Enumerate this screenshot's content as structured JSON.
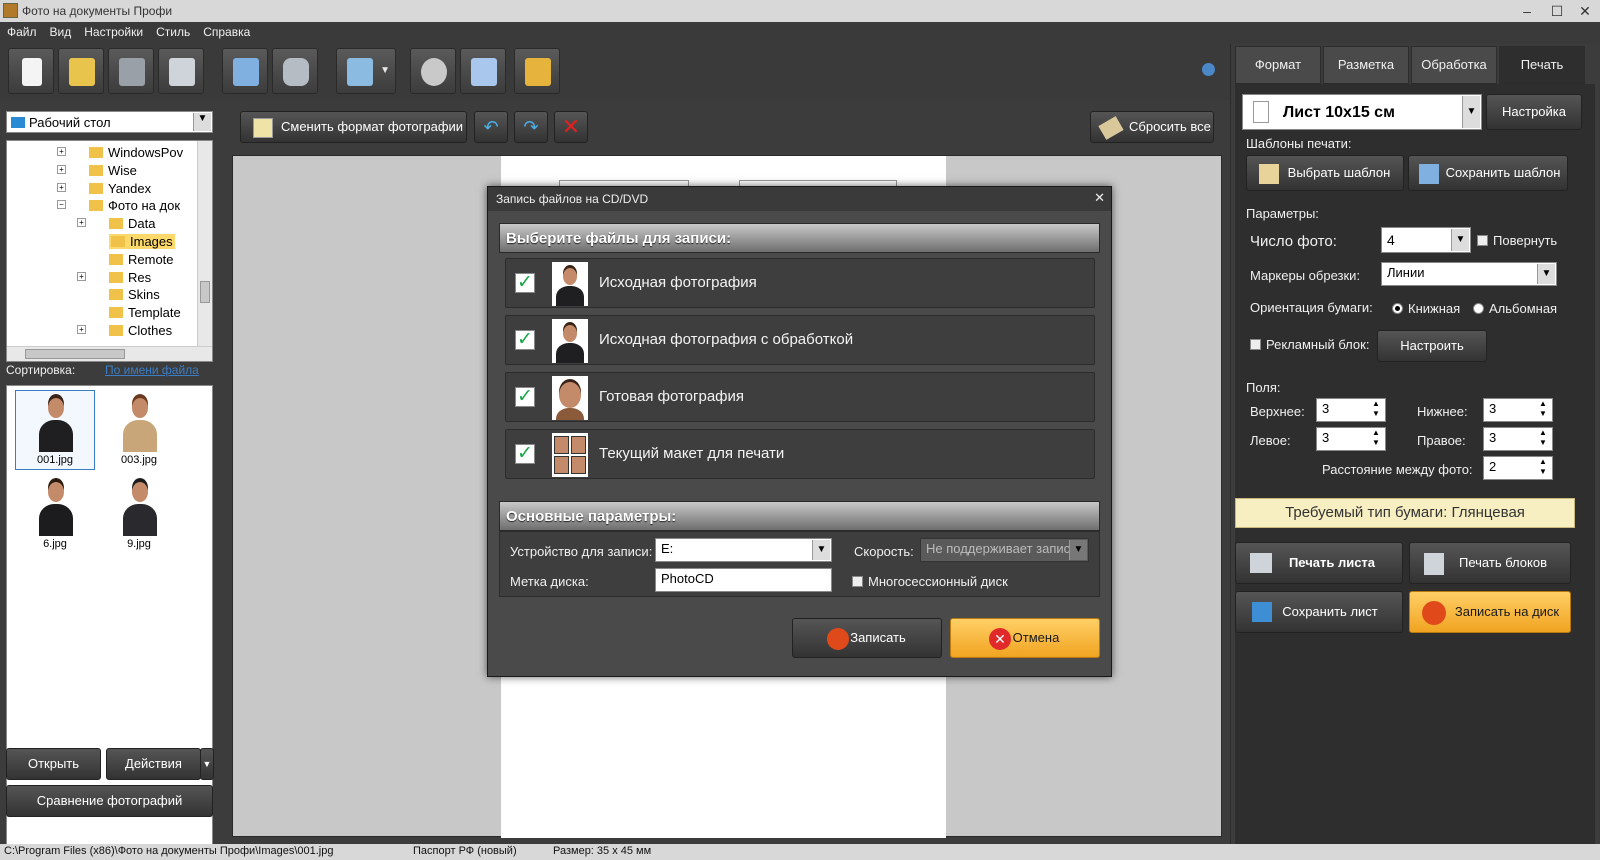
{
  "window": {
    "title": "Фото на документы Профи"
  },
  "menu": [
    "Файл",
    "Вид",
    "Настройки",
    "Стиль",
    "Справка"
  ],
  "folder_select": {
    "value": "Рабочий стол"
  },
  "tree": [
    "WindowsPov",
    "Wise",
    "Yandex",
    "Фото на док",
    "Data",
    "Images",
    "Remote",
    "Res",
    "Skins",
    "Template",
    "Clothes"
  ],
  "sort": {
    "label": "Сортировка:",
    "value": "По имени файла"
  },
  "files": [
    "001.jpg",
    "003.jpg",
    "6.jpg",
    "9.jpg"
  ],
  "left_buttons": {
    "open": "Открыть",
    "actions": "Действия",
    "compare": "Сравнение фотографий"
  },
  "edit_toolbar": {
    "change_format": "Сменить формат фотографии",
    "reset_all": "Сбросить все"
  },
  "tabs": [
    "Формат",
    "Разметка",
    "Обработка",
    "Печать"
  ],
  "print": {
    "sheet": "Лист 10x15 см",
    "setup": "Настройка",
    "templates_label": "Шаблоны печати:",
    "choose_template": "Выбрать шаблон",
    "save_template": "Сохранить шаблон",
    "params_label": "Параметры:",
    "photo_count_label": "Число фото:",
    "photo_count": "4",
    "rotate": "Повернуть",
    "crop_markers_label": "Маркеры обрезки:",
    "crop_markers": "Линии",
    "orientation_label": "Ориентация бумаги:",
    "portrait": "Книжная",
    "landscape": "Альбомная",
    "ad_block": "Рекламный блок:",
    "configure": "Настроить",
    "margins_label": "Поля:",
    "top_label": "Верхнее:",
    "top": "3",
    "bottom_label": "Нижнее:",
    "bottom": "3",
    "left_label": "Левое:",
    "left": "3",
    "right_label": "Правое:",
    "right": "3",
    "spacing_label": "Расстояние между фото:",
    "spacing": "2",
    "paper_type": "Требуемый тип бумаги: Глянцевая",
    "print_sheet": "Печать листа",
    "print_blocks": "Печать блоков",
    "save_sheet": "Сохранить лист",
    "burn_disc": "Записать на диск"
  },
  "dialog": {
    "title": "Запись файлов на CD/DVD",
    "select_header": "Выберите файлы для записи:",
    "items": [
      "Исходная фотография",
      "Исходная фотография с обработкой",
      "Готовая фотография",
      "Текущий макет для печати"
    ],
    "params_header": "Основные параметры:",
    "device_label": "Устройство для записи:",
    "device": "E:",
    "speed_label": "Скорость:",
    "speed": "Не поддерживает запись",
    "disc_label_label": "Метка диска:",
    "disc_label": "PhotoCD",
    "multisession": "Многосессионный диск",
    "burn": "Записать",
    "cancel": "Отмена"
  },
  "status": {
    "path": "C:\\Program Files (x86)\\Фото на документы Профи\\Images\\001.jpg",
    "doc": "Паспорт РФ (новый)",
    "size": "Размер: 35 x 45 мм"
  }
}
